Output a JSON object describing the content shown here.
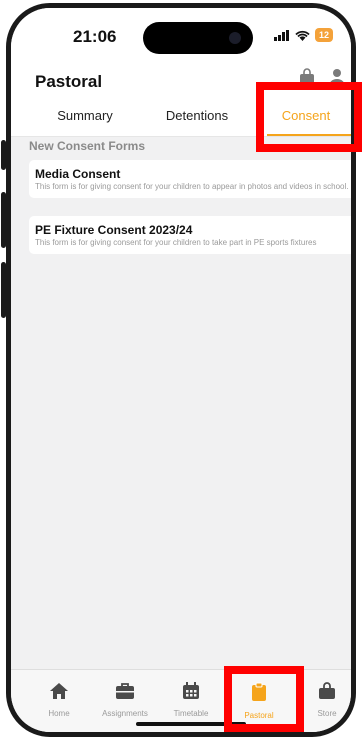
{
  "status_bar": {
    "time": "21:06",
    "battery": "12"
  },
  "header": {
    "title": "Pastoral"
  },
  "tabs": [
    {
      "label": "Summary"
    },
    {
      "label": "Detentions"
    },
    {
      "label": "Consent"
    }
  ],
  "section_label": "New Consent Forms",
  "forms": [
    {
      "title": "Media Consent",
      "description": "This form is for giving consent for your children to appear in photos and videos in school."
    },
    {
      "title": "PE Fixture Consent 2023/24",
      "description": "This form is for giving consent for your children to take part in PE sports fixtures"
    }
  ],
  "tabbar": [
    {
      "label": "Home",
      "icon": "home-icon"
    },
    {
      "label": "Assignments",
      "icon": "briefcase-icon"
    },
    {
      "label": "Timetable",
      "icon": "calendar-icon"
    },
    {
      "label": "Pastoral",
      "icon": "clipboard-icon"
    },
    {
      "label": "Store",
      "icon": "bag-icon"
    }
  ],
  "colors": {
    "accent": "#f5a41b",
    "highlight": "#ff0000"
  }
}
